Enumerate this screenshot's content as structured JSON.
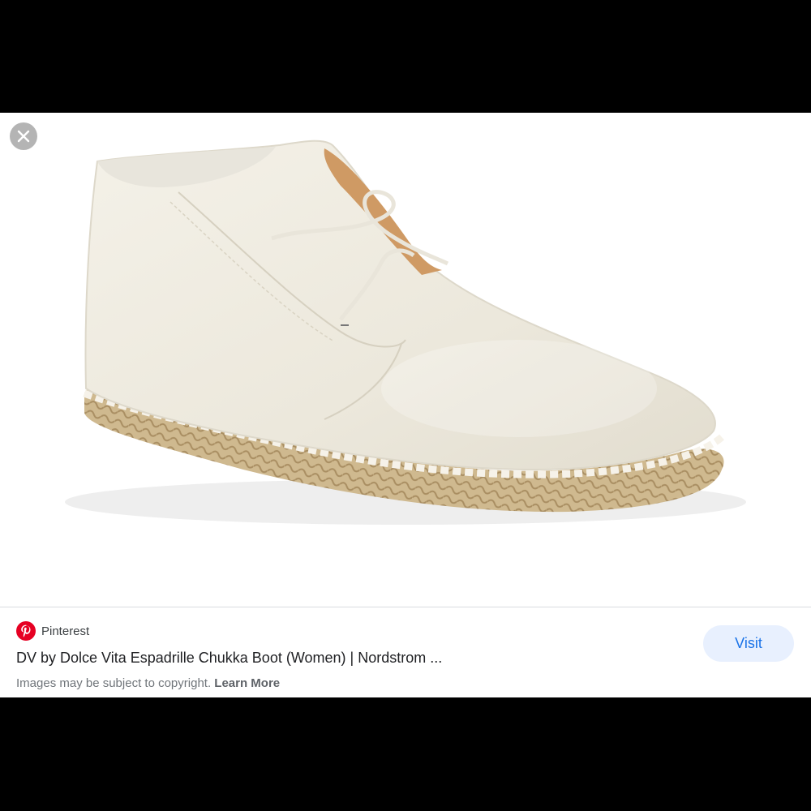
{
  "image": {
    "subject": "white leather espadrille chukka boot with jute sole",
    "close_icon": "close-icon"
  },
  "source": {
    "name": "Pinterest",
    "icon": "pinterest-logo-icon",
    "color": "#E60023"
  },
  "result": {
    "title": "DV by Dolce Vita Espadrille Chukka Boot (Women) | Nordstrom ...",
    "copyright_text": "Images may be subject to copyright.",
    "learn_more": "Learn More"
  },
  "actions": {
    "visit_label": "Visit"
  },
  "colors": {
    "visit_bg": "#E8F0FE",
    "visit_text": "#1A73E8",
    "background": "#000000"
  }
}
